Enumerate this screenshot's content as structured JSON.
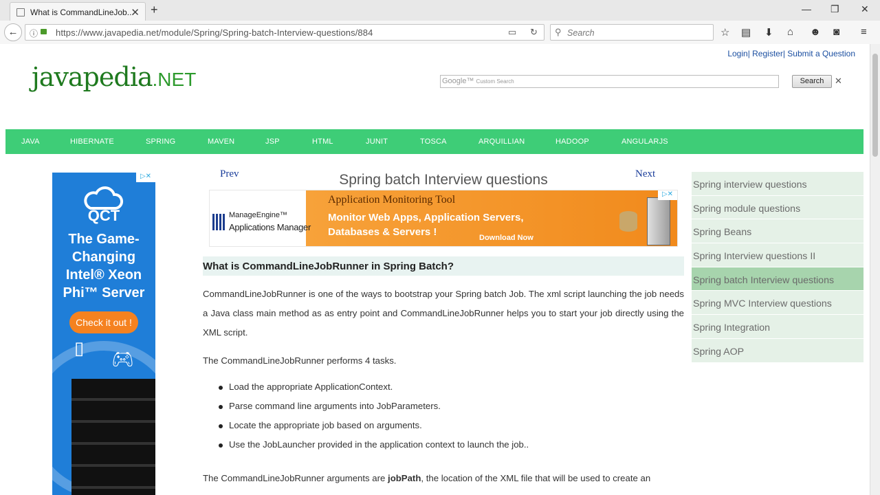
{
  "browser": {
    "tab_title": "What is CommandLineJob...",
    "url": "https://www.javapedia.net/module/Spring/Spring-batch-Interview-questions/884",
    "search_placeholder": "Search"
  },
  "header": {
    "links": "Login| Register| Submit a Question",
    "logo_main": "javapedia",
    "logo_tld": ".NET",
    "google_placeholder_brand": "Google™",
    "google_placeholder_text": "Custom Search",
    "google_search_button": "Search"
  },
  "menu": [
    "JAVA",
    "HIBERNATE",
    "SPRING",
    "MAVEN",
    "JSP",
    "HTML",
    "JUNIT",
    "TOSCA",
    "ARQUILLIAN",
    "HADOOP",
    "ANGULARJS"
  ],
  "left_ad": {
    "brand": "QCT",
    "tagline": "The Game-Changing Intel® Xeon Phi™ Server",
    "cta": "Check it out !"
  },
  "content": {
    "prev": "Prev",
    "next": "Next",
    "title": "Spring batch Interview questions",
    "banner": {
      "brand_line1": "ManageEngine™",
      "brand_line2": "Applications Manager",
      "headline": "Application Monitoring Tool",
      "body": "Monitor Web Apps, Application Servers, Databases & Servers !",
      "cta": "Download Now"
    },
    "question": "What is CommandLineJobRunner in Spring Batch?",
    "para1": "CommandLineJobRunner is one of the ways to bootstrap your Spring batch Job. The xml script launching the job needs a Java class main method as as entry point and CommandLineJobRunner helps you to start your job directly using the XML script.",
    "para2": "The CommandLineJobRunner performs 4 tasks.",
    "tasks": [
      "Load the appropriate ApplicationContext.",
      "Parse command line arguments into JobParameters.",
      "Locate the appropriate job based on arguments.",
      "Use the JobLauncher provided in the application context to launch the job.."
    ],
    "para3_pre": "The CommandLineJobRunner arguments are ",
    "para3_bold": "jobPath",
    "para3_post": ", the location of the XML file that will be used to create an"
  },
  "sidebar": {
    "items": [
      "Spring interview questions",
      "Spring module questions",
      "Spring Beans",
      "Spring Interview questions II",
      "Spring batch Interview questions",
      "Spring MVC Interview questions",
      "Spring Integration",
      "Spring AOP"
    ],
    "active_index": 4
  },
  "colors": {
    "menu_bar": "#3ecd77",
    "sidebar_bg": "#e5f1e7",
    "sidebar_active": "#a7d4ad",
    "ad_blue": "#1f7ed8",
    "banner_orange": "#f18a1c"
  }
}
